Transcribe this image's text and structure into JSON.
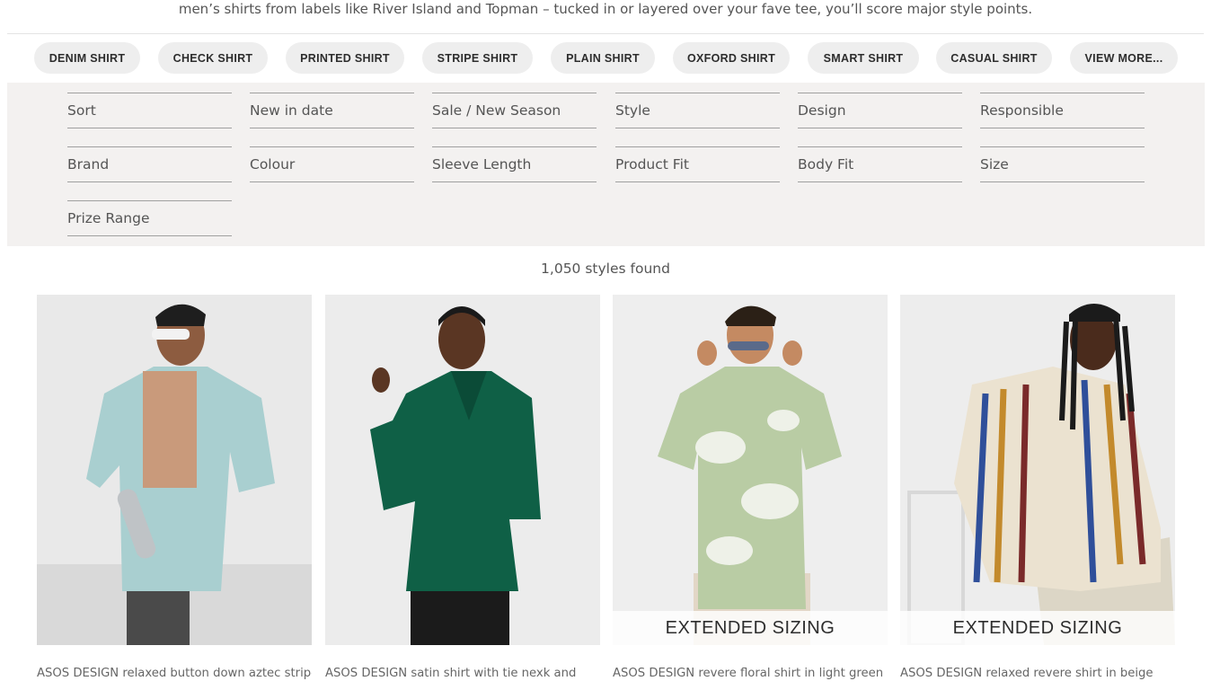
{
  "intro_text": "men’s shirts from labels like River Island and Topman – tucked in or layered over your fave tee, you’ll score major style points.",
  "chips": [
    {
      "label": "DENIM SHIRT"
    },
    {
      "label": "CHECK SHIRT"
    },
    {
      "label": "PRINTED SHIRT"
    },
    {
      "label": "STRIPE SHIRT"
    },
    {
      "label": "PLAIN SHIRT"
    },
    {
      "label": "OXFORD SHIRT"
    },
    {
      "label": "SMART SHIRT"
    },
    {
      "label": "CASUAL SHIRT"
    },
    {
      "label": "VIEW MORE..."
    }
  ],
  "filters": [
    {
      "label": "Sort"
    },
    {
      "label": "New in date"
    },
    {
      "label": "Sale / New Season"
    },
    {
      "label": "Style"
    },
    {
      "label": "Design"
    },
    {
      "label": "Responsible"
    },
    {
      "label": "Brand"
    },
    {
      "label": "Colour"
    },
    {
      "label": "Sleeve Length"
    },
    {
      "label": "Product Fit"
    },
    {
      "label": "Body Fit"
    },
    {
      "label": "Size"
    },
    {
      "label": "Prize Range"
    }
  ],
  "results_count": "1,050 styles found",
  "products": [
    {
      "title": "ASOS DESIGN relaxed button down aztec stripe",
      "badge": "",
      "shirt_color": "#a9cfd0",
      "pattern": "aztec"
    },
    {
      "title": "ASOS DESIGN satin shirt with tie nexk and",
      "badge": "",
      "shirt_color": "#0f6046",
      "pattern": "satin"
    },
    {
      "title": "ASOS DESIGN revere floral shirt in light green",
      "badge": "EXTENDED SIZING",
      "shirt_color": "#b9cca4",
      "pattern": "floral"
    },
    {
      "title": "ASOS DESIGN relaxed revere shirt in beige",
      "badge": "EXTENDED SIZING",
      "shirt_color": "#ebe2d0",
      "pattern": "stripes"
    }
  ],
  "colors": {
    "chip_bg": "#eeeeee",
    "filter_panel_bg": "#f3f1f0",
    "text": "#2d2d2d",
    "muted": "#555555"
  }
}
